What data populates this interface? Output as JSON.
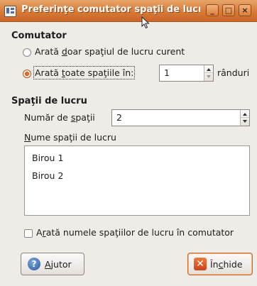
{
  "window": {
    "title": "Preferinţe comutator spaţii de lucru",
    "controls": {
      "minimize": "_",
      "maximize": "□",
      "close": "×"
    }
  },
  "switcher": {
    "section_title": "Comutator",
    "radio_current": {
      "before": "Arată ",
      "mnemonic": "d",
      "after": "oar spaţiul de lucru curent",
      "selected": false
    },
    "radio_all": {
      "before": "Arată ",
      "mnemonic": "t",
      "after": "oate spaţiile în:",
      "selected": true
    },
    "rows_value": "1",
    "rows_suffix": "rânduri"
  },
  "workspaces": {
    "section_title": "Spaţii de lucru",
    "count_label": {
      "before": "Număr de ",
      "mnemonic": "s",
      "after": "paţii"
    },
    "count_value": "2",
    "names_label": {
      "before": "",
      "mnemonic": "N",
      "after": "ume spaţii de lucru"
    },
    "names": [
      "Birou 1",
      "Birou 2"
    ],
    "show_names": {
      "before": "A",
      "mnemonic": "r",
      "after": "ată numele spaţiilor de lucru în comutator",
      "checked": false
    }
  },
  "buttons": {
    "help": {
      "before": "",
      "mnemonic": "A",
      "after": "jutor",
      "icon": "help-icon"
    },
    "close": {
      "before": "În",
      "mnemonic": "c",
      "after": "hide",
      "icon": "close-icon"
    }
  },
  "colors": {
    "titlebar": "#d87a36",
    "accent": "#e06b1f",
    "dialog_bg": "#efebe7"
  }
}
